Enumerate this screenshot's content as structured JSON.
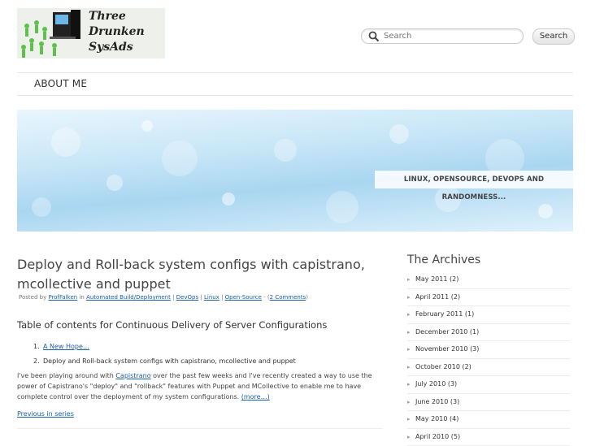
{
  "header": {
    "logo_line1": "Three",
    "logo_line2": "Drunken",
    "logo_line3": "SysAds",
    "search_placeholder": "Search",
    "search_button": "Search"
  },
  "nav": {
    "about": "ABOUT ME"
  },
  "banner": {
    "tagline": "LINUX, OPENSOURCE, DEVOPS AND RANDOMNESS..."
  },
  "post": {
    "title": "Deploy and Roll-back system configs with capistrano, mcollective and puppet",
    "posted_by": "Posted by",
    "author": "ProfFalken",
    "in_word": "in",
    "categories": [
      "Automated Build/Deployment",
      "DevOps",
      "Linux",
      "Open-Source"
    ],
    "comments": "2 Comments",
    "toc_title": "Table of contents for Continuous Delivery of Server Configurations",
    "toc_items": [
      {
        "num": "1.",
        "text": "A New Hope…"
      },
      {
        "num": "2.",
        "text": "Deploy and Roll-back system configs with capistrano, mcollective and puppet"
      }
    ],
    "body_before": "I've been playing around with ",
    "body_link": "Capistrano",
    "body_after": " over the past few weeks and I've recently created a way to use the power of Capistrano's \"deploy\" and \"rollback\" features with Puppet and MCollective to enable me to have complete control over the deployment of my system configurations. ",
    "more": "(more…)",
    "prev": "Previous in series"
  },
  "sidebar": {
    "title": "The Archives",
    "archives": [
      "May 2011 (2)",
      "April 2011 (2)",
      "February 2011 (1)",
      "December 2010 (1)",
      "November 2010 (3)",
      "October 2010 (2)",
      "July 2010 (3)",
      "June 2010 (3)",
      "May 2010 (4)",
      "April 2010 (5)"
    ]
  }
}
